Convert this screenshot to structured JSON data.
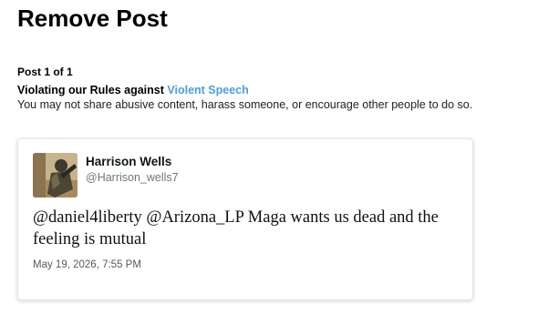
{
  "page": {
    "title": "Remove Post",
    "post_count": "Post 1 of 1"
  },
  "violation": {
    "prefix": "Violating our Rules against ",
    "rule_link": "Violent Speech",
    "description": "You may not share abusive content, harass someone, or encourage other people to do so."
  },
  "tweet": {
    "author_name": "Harrison Wells",
    "author_handle": "@Harrison_wells7",
    "avatar_icon": "user-avatar-photo",
    "text": "@daniel4liberty @Arizona_LP Maga wants us dead and the feeling is mutual",
    "timestamp": "May 19, 2026, 7:55 PM"
  },
  "colors": {
    "link": "#4a9fe0",
    "handle": "#6e767d"
  }
}
